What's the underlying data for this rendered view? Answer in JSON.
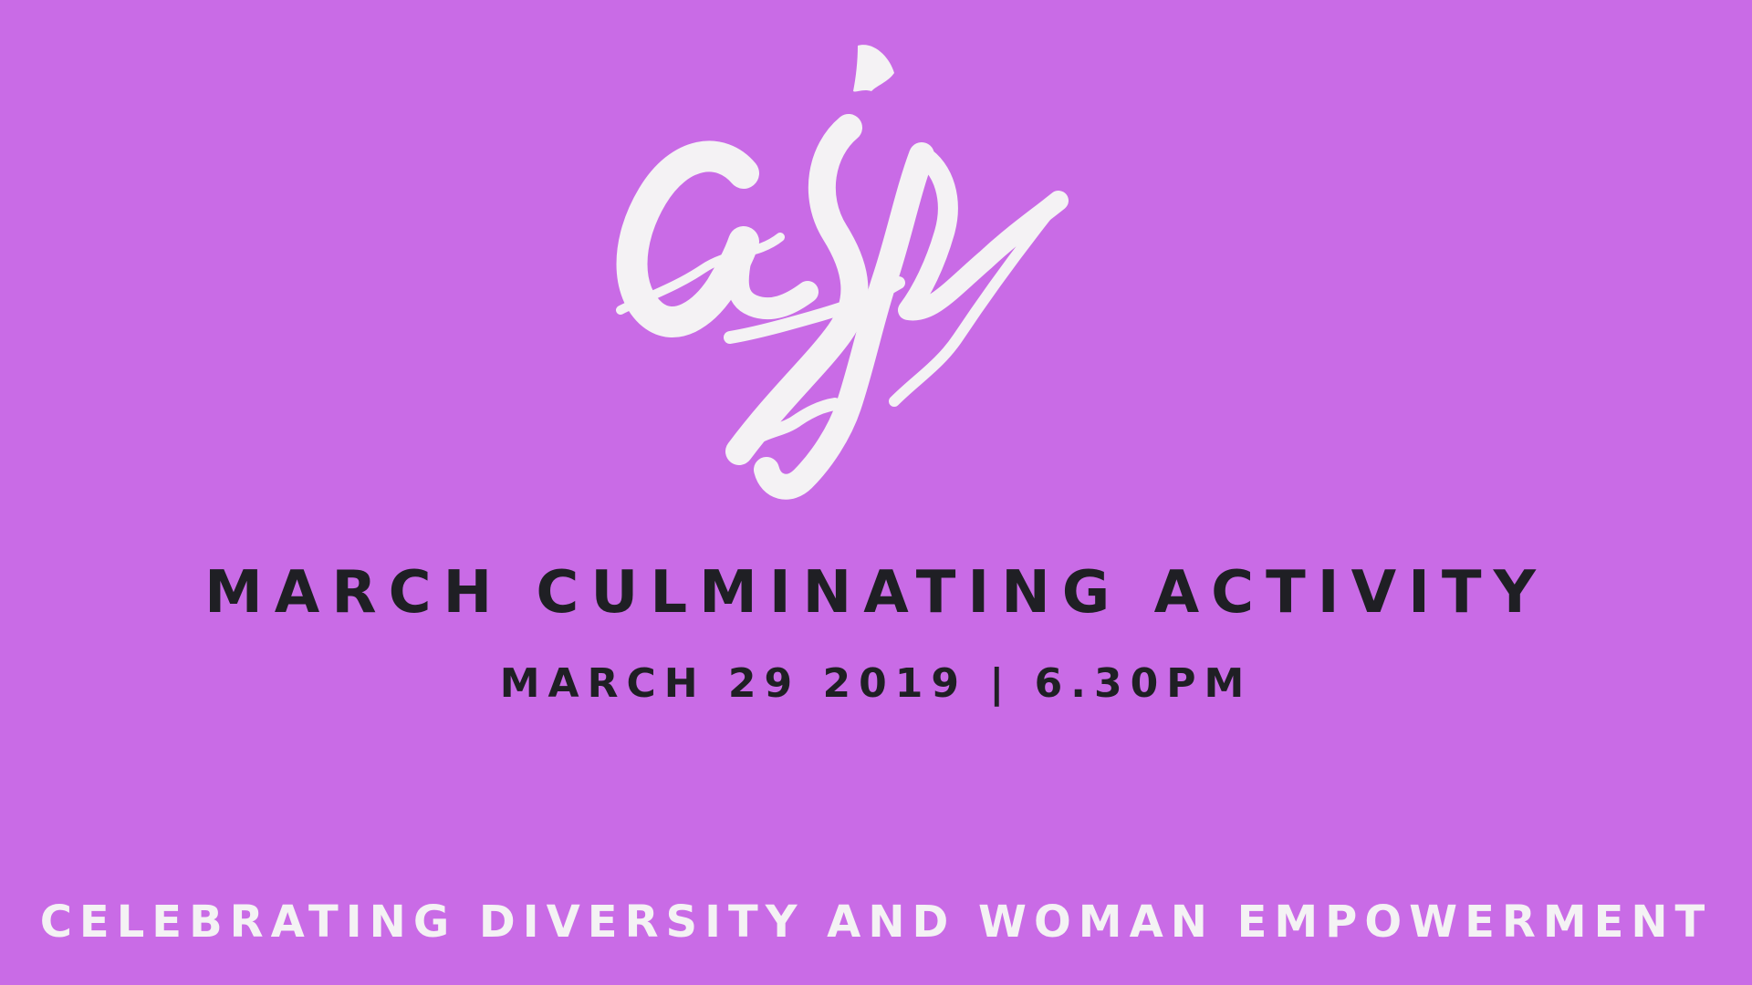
{
  "colors": {
    "background": "#c96be6",
    "heading": "#1f1f24",
    "tagline": "#f4f2f4",
    "logo": "#f4f2f4"
  },
  "logo": {
    "text": "asj",
    "icon": "asj-brush-script-logo"
  },
  "event": {
    "title": "MARCH CULMINATING ACTIVITY",
    "datetime": "MARCH 29 2019 | 6.30PM"
  },
  "tagline": "CELEBRATING DIVERSITY AND WOMAN EMPOWERMENT"
}
